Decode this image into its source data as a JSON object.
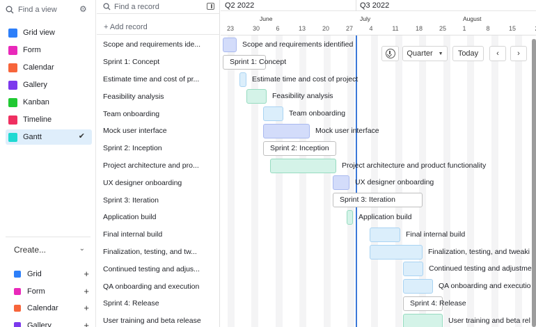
{
  "sidebar": {
    "find_view_placeholder": "Find a view",
    "views": [
      {
        "label": "Grid view",
        "icon": "grid-icon",
        "color": "#2d7ff9",
        "active": false
      },
      {
        "label": "Form",
        "icon": "form-icon",
        "color": "#e929ba",
        "active": false
      },
      {
        "label": "Calendar",
        "icon": "calendar-icon",
        "color": "#f7653b",
        "active": false
      },
      {
        "label": "Gallery",
        "icon": "gallery-icon",
        "color": "#7c39ed",
        "active": false
      },
      {
        "label": "Kanban",
        "icon": "kanban-icon",
        "color": "#20c933",
        "active": false
      },
      {
        "label": "Timeline",
        "icon": "timeline-icon",
        "color": "#ef3061",
        "active": false
      },
      {
        "label": "Gantt",
        "icon": "gantt-icon",
        "color": "#20d9d2",
        "active": true
      }
    ],
    "create_label": "Create...",
    "create_items": [
      {
        "label": "Grid",
        "icon": "grid-icon",
        "color": "#2d7ff9"
      },
      {
        "label": "Form",
        "icon": "form-icon",
        "color": "#e929ba"
      },
      {
        "label": "Calendar",
        "icon": "calendar-icon",
        "color": "#f7653b"
      },
      {
        "label": "Gallery",
        "icon": "gallery-icon",
        "color": "#7c39ed"
      }
    ]
  },
  "records": {
    "search_placeholder": "Find a record",
    "add_label": "+ Add record",
    "rows": [
      "Scope and requirements ide...",
      "Sprint 1: Concept",
      "Estimate time and cost of pr...",
      "Feasibility analysis",
      "Team onboarding",
      "Mock user interface",
      "Sprint 2: Inception",
      "Project architecture and pro...",
      "UX designer onboarding",
      "Sprint 3: Iteration",
      "Application build",
      "Final internal build",
      "Finalization, testing, and tw...",
      "Continued testing and adjus...",
      "QA onboarding and execution",
      "Sprint 4: Release",
      "User training and beta release"
    ]
  },
  "timeline": {
    "quarters": [
      "Q2 2022",
      "Q3 2022"
    ],
    "months": [
      "June",
      "July",
      "August"
    ],
    "days": [
      "23",
      "30",
      "6",
      "13",
      "20",
      "27",
      "4",
      "11",
      "18",
      "25",
      "1",
      "8",
      "15",
      "2"
    ],
    "bars": [
      {
        "label": "Scope and requirements identified",
        "style": "blue"
      },
      {
        "label": "Sprint 1: Concept",
        "style": "white"
      },
      {
        "label": "Estimate time and cost of project",
        "style": "lightblue"
      },
      {
        "label": "Feasibility analysis",
        "style": "green"
      },
      {
        "label": "Team onboarding",
        "style": "lightblue"
      },
      {
        "label": "Mock user interface",
        "style": "blue"
      },
      {
        "label": "Sprint 2: Inception",
        "style": "white"
      },
      {
        "label": "Project architecture and product functionality",
        "style": "green"
      },
      {
        "label": "UX designer onboarding",
        "style": "blue"
      },
      {
        "label": "Sprint 3: Iteration",
        "style": "white"
      },
      {
        "label": "Application build",
        "style": "green"
      },
      {
        "label": "Final internal build",
        "style": "lightblue"
      },
      {
        "label": "Finalization, testing, and tweaki",
        "style": "lightblue"
      },
      {
        "label": "Continued testing and adjustme",
        "style": "lightblue"
      },
      {
        "label": "QA onboarding and executio",
        "style": "lightblue"
      },
      {
        "label": "Sprint 4: Release",
        "style": "white"
      },
      {
        "label": "User training and beta rel",
        "style": "green"
      }
    ],
    "controls": {
      "download_icon": "download-icon",
      "zoom_label": "Quarter",
      "today_label": "Today",
      "prev_label": "‹",
      "next_label": "›"
    }
  }
}
